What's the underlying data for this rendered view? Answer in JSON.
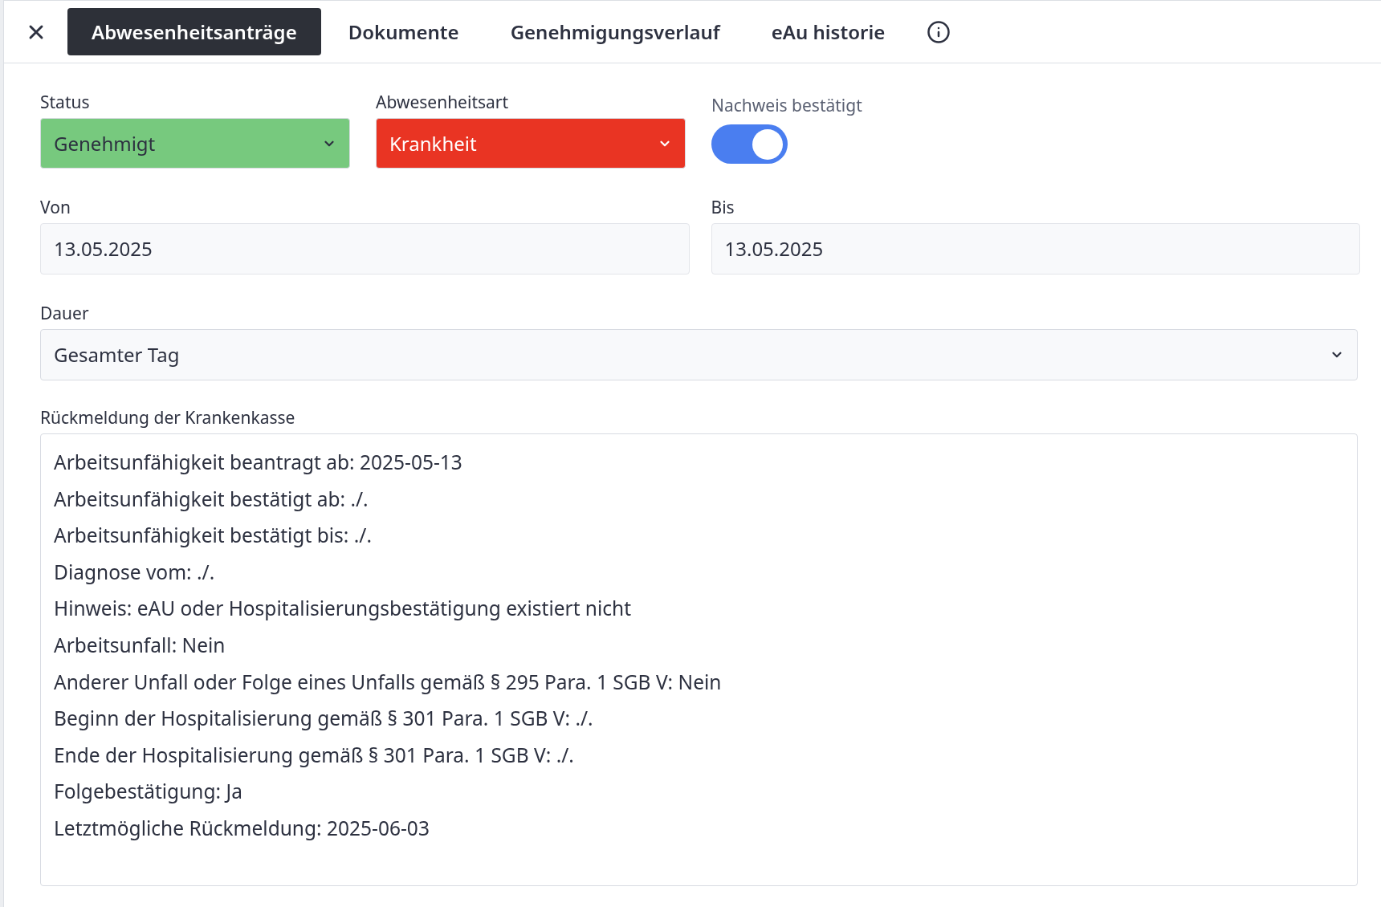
{
  "tabs": [
    {
      "label": "Abwesenheitsanträge",
      "selected": true
    },
    {
      "label": "Dokumente",
      "selected": false
    },
    {
      "label": "Genehmigungsverlauf",
      "selected": false
    },
    {
      "label": "eAu historie",
      "selected": false
    }
  ],
  "top_fields": [
    {
      "kind": "select",
      "label": "Status",
      "value": "Genehmigt",
      "color": "#77c97e"
    },
    {
      "kind": "select",
      "label": "Abwesenheitsart",
      "value": "Krankheit",
      "color": "#e93423"
    },
    {
      "kind": "toggle",
      "label": "Nachweis bestätigt",
      "on": true
    }
  ],
  "dates": [
    {
      "label": "Von",
      "value": "13.05.2025"
    },
    {
      "label": "Bis",
      "value": "13.05.2025"
    }
  ],
  "duration": {
    "label": "Dauer",
    "value": "Gesamter Tag"
  },
  "feedback": {
    "label": "Rückmeldung der Krankenkasse",
    "lines": [
      "Arbeitsunfähigkeit beantragt ab: 2025-05-13",
      "Arbeitsunfähigkeit bestätigt ab: ./.",
      "Arbeitsunfähigkeit bestätigt bis: ./.",
      "Diagnose vom: ./.",
      "Hinweis: eAU oder Hospitalisierungsbestätigung existiert nicht",
      "Arbeitsunfall: Nein",
      "Anderer Unfall oder Folge eines Unfalls gemäß § 295 Para. 1 SGB V: Nein",
      "Beginn der Hospitalisierung gemäß § 301 Para. 1 SGB V: ./.",
      "Ende der Hospitalisierung gemäß § 301 Para. 1 SGB V: ./.",
      "Folgebestätigung: Ja",
      "Letztmögliche Rückmeldung: 2025-06-03"
    ]
  }
}
